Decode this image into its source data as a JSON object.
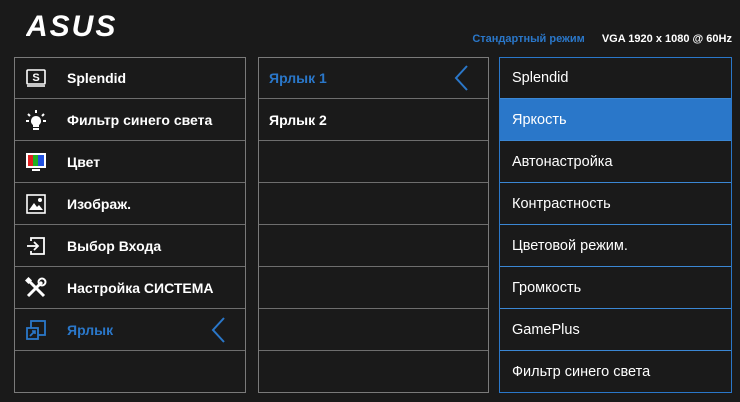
{
  "header": {
    "logo_text": "ASUS",
    "mode": "Стандартный режим",
    "resolution": "VGA 1920 x 1080 @ 60Hz"
  },
  "main_menu": [
    {
      "label": "Splendid",
      "icon": "splendid-icon"
    },
    {
      "label": "Фильтр синего света",
      "icon": "blue-light-filter-icon"
    },
    {
      "label": "Цвет",
      "icon": "color-icon"
    },
    {
      "label": "Изображ.",
      "icon": "image-icon"
    },
    {
      "label": "Выбор Входа",
      "icon": "input-select-icon"
    },
    {
      "label": "Настройка СИСТЕМА",
      "icon": "system-setup-icon"
    },
    {
      "label": "Ярлык",
      "icon": "shortcut-icon",
      "selected": true
    }
  ],
  "submenu": [
    {
      "label": "Ярлык 1",
      "selected": true
    },
    {
      "label": "Ярлык 2"
    }
  ],
  "options": [
    {
      "label": "Splendid"
    },
    {
      "label": "Яркость",
      "highlighted": true
    },
    {
      "label": "Автонастройка"
    },
    {
      "label": "Контрастность"
    },
    {
      "label": "Цветовой режим."
    },
    {
      "label": "Громкость"
    },
    {
      "label": "GamePlus"
    },
    {
      "label": "Фильтр синего света"
    }
  ],
  "colors": {
    "accent": "#2a77c9",
    "background": "#1a1a1a",
    "border": "#7a7a7a",
    "text": "#ffffff"
  }
}
